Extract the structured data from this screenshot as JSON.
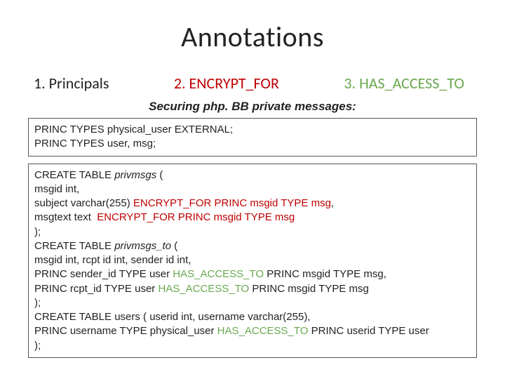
{
  "title": "Annotations",
  "legend": {
    "item1": "1. Principals",
    "item2": "2. ENCRYPT_FOR",
    "item3": "3. HAS_ACCESS_TO"
  },
  "subtitle": "Securing php. BB private messages:",
  "box1": {
    "line1_a": "PRINC TYPES",
    "line1_b": " physical_user EXTERNAL;",
    "line2_a": "PRINC TYPES",
    "line2_b": " user, msg;"
  },
  "box2": {
    "l1_a": "CREATE TABLE ",
    "l1_b": "privmsgs",
    "l1_c": " (",
    "l2": "msgid int,",
    "l3_a": "subject varchar(255) ",
    "l3_b": "ENCRYPT_FOR PRINC msgid TYPE msg",
    "l3_c": ",",
    "l4_a": "msgtext text  ",
    "l4_b": "ENCRYPT_FOR PRINC msgid TYPE msg",
    "l5": ");",
    "l6_a": "CREATE TABLE ",
    "l6_b": "privmsgs_to",
    "l6_c": " (",
    "l7": "msgid int, rcpt id int, sender id int,",
    "l8_a": "PRINC sender_id TYPE user ",
    "l8_b": "HAS_ACCESS_TO",
    "l8_c": " PRINC msgid TYPE msg,",
    "l9_a": "PRINC rcpt_id TYPE user ",
    "l9_b": "HAS_ACCESS_TO",
    "l9_c": " PRINC msgid TYPE msg",
    "l10": ");",
    "l11": "CREATE TABLE users ( userid int, username varchar(255),",
    "l12_a": "PRINC username TYPE physical_user ",
    "l12_b": "HAS_ACCESS_TO",
    "l12_c": " PRINC userid TYPE user",
    "l13": ");"
  }
}
